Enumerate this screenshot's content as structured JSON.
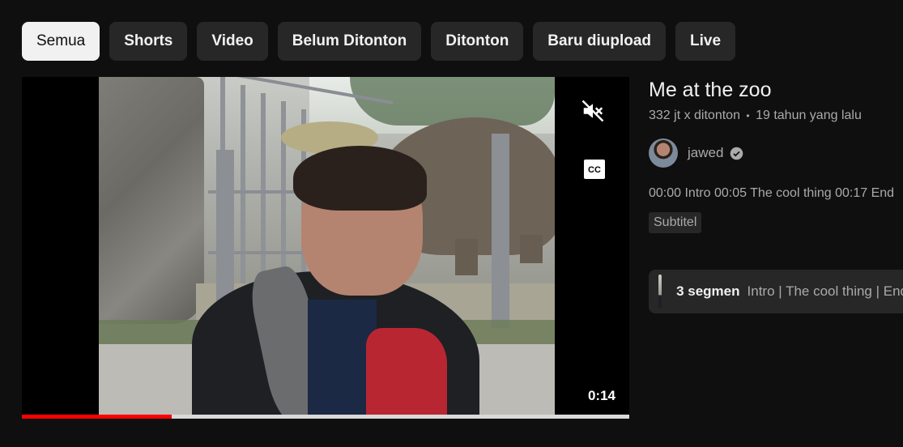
{
  "chips": [
    {
      "label": "Semua",
      "active": true
    },
    {
      "label": "Shorts",
      "active": false
    },
    {
      "label": "Video",
      "active": false
    },
    {
      "label": "Belum Ditonton",
      "active": false
    },
    {
      "label": "Ditonton",
      "active": false
    },
    {
      "label": "Baru diupload",
      "active": false
    },
    {
      "label": "Live",
      "active": false
    }
  ],
  "player": {
    "mute_icon": "muted-speaker-icon",
    "cc_icon": "closed-captions-icon",
    "cc_label": "CC",
    "duration": "0:14",
    "progress": 0.246,
    "progress_color": "#ff0000"
  },
  "video": {
    "title": "Me at the zoo",
    "views": "332 jt x ditonton",
    "separator": "•",
    "age": "19 tahun yang lalu",
    "channel": "jawed",
    "verified_icon": "verified-check-icon",
    "description": "00:00 Intro 00:05 The cool thing 00:17 End",
    "badge": "Subtitel",
    "segments_count": "3 segmen",
    "segments_names": "Intro | The cool thing | End"
  }
}
